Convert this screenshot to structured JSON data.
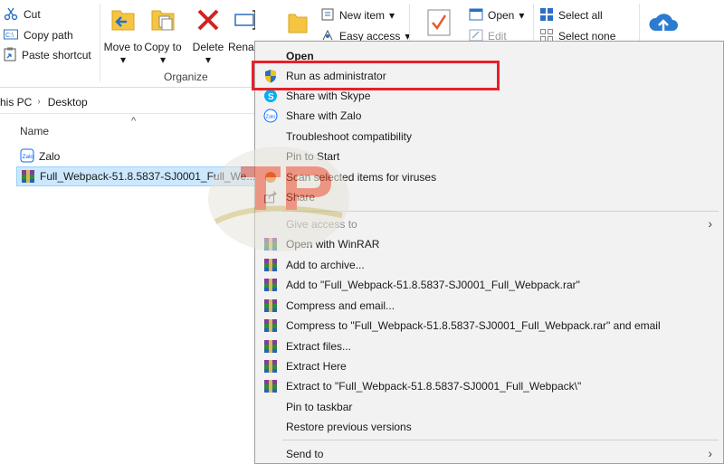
{
  "ribbon": {
    "clipboard": {
      "cut": "Cut",
      "copy_path": "Copy path",
      "paste_shortcut": "Paste shortcut"
    },
    "organize": {
      "move_to": "Move to",
      "copy_to": "Copy to",
      "delete": "Delete",
      "rename": "Rena",
      "label": "Organize"
    },
    "new": {
      "new_item": "New item",
      "easy_access": "Easy access"
    },
    "open": {
      "open": "Open",
      "edit": "Edit"
    },
    "select": {
      "select_all": "Select all",
      "select_none": "Select none"
    }
  },
  "address": {
    "crumbs": [
      "his PC",
      "Desktop"
    ]
  },
  "filelist": {
    "column_name": "Name",
    "files": [
      {
        "label": "Zalo"
      },
      {
        "label": "Full_Webpack-51.8.5837-SJ0001_Full_We..."
      }
    ]
  },
  "context_menu": {
    "items": [
      {
        "label": "Open"
      },
      {
        "label": "Run as administrator"
      },
      {
        "label": "Share with Skype"
      },
      {
        "label": "Share with Zalo"
      },
      {
        "label": "Troubleshoot compatibility"
      },
      {
        "label": "Pin to Start"
      },
      {
        "label": "Scan selected items for viruses"
      },
      {
        "label": "Share"
      },
      {
        "label": "Give access to"
      },
      {
        "label": "Open with WinRAR"
      },
      {
        "label": "Add to archive..."
      },
      {
        "label": "Add to \"Full_Webpack-51.8.5837-SJ0001_Full_Webpack.rar\""
      },
      {
        "label": "Compress and email..."
      },
      {
        "label": "Compress to \"Full_Webpack-51.8.5837-SJ0001_Full_Webpack.rar\" and email"
      },
      {
        "label": "Extract files..."
      },
      {
        "label": "Extract Here"
      },
      {
        "label": "Extract to \"Full_Webpack-51.8.5837-SJ0001_Full_Webpack\\\""
      },
      {
        "label": "Pin to taskbar"
      },
      {
        "label": "Restore previous versions"
      },
      {
        "label": "Send to"
      }
    ]
  },
  "colors": {
    "highlight_border": "#e8202a",
    "selection_bg": "#cce8ff",
    "menu_bg": "#f2f2f2"
  },
  "icons": [
    "scissors-icon",
    "copy-path-icon",
    "paste-shortcut-icon",
    "move-to-icon",
    "copy-to-icon",
    "delete-icon",
    "rename-icon",
    "folder-icon",
    "new-item-icon",
    "easy-access-icon",
    "properties-icon",
    "open-icon",
    "edit-icon",
    "select-all-icon",
    "select-none-icon",
    "cloud-upload-icon",
    "uac-shield-icon",
    "skype-icon",
    "zalo-icon",
    "share-icon",
    "winrar-icon",
    "watermark-logo"
  ]
}
